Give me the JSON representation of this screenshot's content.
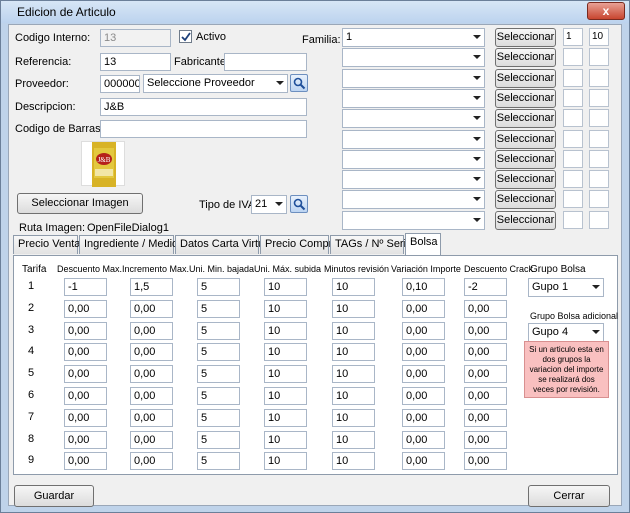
{
  "window": {
    "title": "Edicion de Articulo",
    "close": "x"
  },
  "fields": {
    "codigo_interno_label": "Codigo Interno:",
    "codigo_interno_value": "13",
    "activo_label": "Activo",
    "referencia_label": "Referencia:",
    "referencia_value": "13",
    "fabricante_label": "Fabricante:",
    "fabricante_value": "",
    "proveedor_label": "Proveedor:",
    "proveedor_code": "000000",
    "proveedor_select": "Seleccione Proveedor",
    "descripcion_label": "Descripcion:",
    "descripcion_value": "J&B",
    "codigo_barras_label": "Codigo de Barras:",
    "codigo_barras_value": ""
  },
  "familia": {
    "label": "Familia:",
    "button_label": "Seleccionar",
    "rows": [
      {
        "value": "1",
        "a": "1",
        "b": "10"
      },
      {
        "value": "",
        "a": "",
        "b": ""
      },
      {
        "value": "",
        "a": "",
        "b": ""
      },
      {
        "value": "",
        "a": "",
        "b": ""
      },
      {
        "value": "",
        "a": "",
        "b": ""
      },
      {
        "value": "",
        "a": "",
        "b": ""
      },
      {
        "value": "",
        "a": "",
        "b": ""
      },
      {
        "value": "",
        "a": "",
        "b": ""
      },
      {
        "value": "",
        "a": "",
        "b": ""
      },
      {
        "value": "",
        "a": "",
        "b": ""
      }
    ]
  },
  "imagen": {
    "button_label": "Seleccionar Imagen",
    "ruta_label": "Ruta Imagen:",
    "ruta_value": "OpenFileDialog1"
  },
  "iva": {
    "label": "Tipo de IVA",
    "value": "21"
  },
  "tabs": [
    "Precio Venta",
    "Ingrediente / Medidas",
    "Datos Carta Virtual",
    "Precio Compra",
    "TAGs / Nº Serie",
    "Bolsa"
  ],
  "active_tab": 5,
  "grid": {
    "headers": [
      "Tarifa",
      "Descuento Max.",
      "Incremento Max.",
      "Uni. Min. bajada",
      "Uni. Máx. subida",
      "Minutos revisión",
      "Variación Importe",
      "Descuento Crack"
    ],
    "rows": [
      {
        "tarifa": "1",
        "desc": "-1",
        "inc": "1,5",
        "min": "5",
        "max": "10",
        "mins": "10",
        "var": "0,10",
        "crack": "-2"
      },
      {
        "tarifa": "2",
        "desc": "0,00",
        "inc": "0,00",
        "min": "5",
        "max": "10",
        "mins": "10",
        "var": "0,00",
        "crack": "0,00"
      },
      {
        "tarifa": "3",
        "desc": "0,00",
        "inc": "0,00",
        "min": "5",
        "max": "10",
        "mins": "10",
        "var": "0,00",
        "crack": "0,00"
      },
      {
        "tarifa": "4",
        "desc": "0,00",
        "inc": "0,00",
        "min": "5",
        "max": "10",
        "mins": "10",
        "var": "0,00",
        "crack": "0,00"
      },
      {
        "tarifa": "5",
        "desc": "0,00",
        "inc": "0,00",
        "min": "5",
        "max": "10",
        "mins": "10",
        "var": "0,00",
        "crack": "0,00"
      },
      {
        "tarifa": "6",
        "desc": "0,00",
        "inc": "0,00",
        "min": "5",
        "max": "10",
        "mins": "10",
        "var": "0,00",
        "crack": "0,00"
      },
      {
        "tarifa": "7",
        "desc": "0,00",
        "inc": "0,00",
        "min": "5",
        "max": "10",
        "mins": "10",
        "var": "0,00",
        "crack": "0,00"
      },
      {
        "tarifa": "8",
        "desc": "0,00",
        "inc": "0,00",
        "min": "5",
        "max": "10",
        "mins": "10",
        "var": "0,00",
        "crack": "0,00"
      },
      {
        "tarifa": "9",
        "desc": "0,00",
        "inc": "0,00",
        "min": "5",
        "max": "10",
        "mins": "10",
        "var": "0,00",
        "crack": "0,00"
      }
    ]
  },
  "bolsa": {
    "grupo_label": "Grupo Bolsa",
    "grupo_value": "Gupo 1",
    "grupo_adicional_label": "Grupo Bolsa adicional",
    "grupo_adicional_value": "Gupo 4",
    "note": "Si un articulo esta en dos grupos la variacion del importe se realizará dos veces por revisión."
  },
  "footer": {
    "guardar": "Guardar",
    "cerrar": "Cerrar"
  },
  "product_image": {
    "label": "J&B"
  },
  "icons": {
    "search": "search-icon",
    "check": "check-icon",
    "dropdown": "chevron-down-icon"
  }
}
